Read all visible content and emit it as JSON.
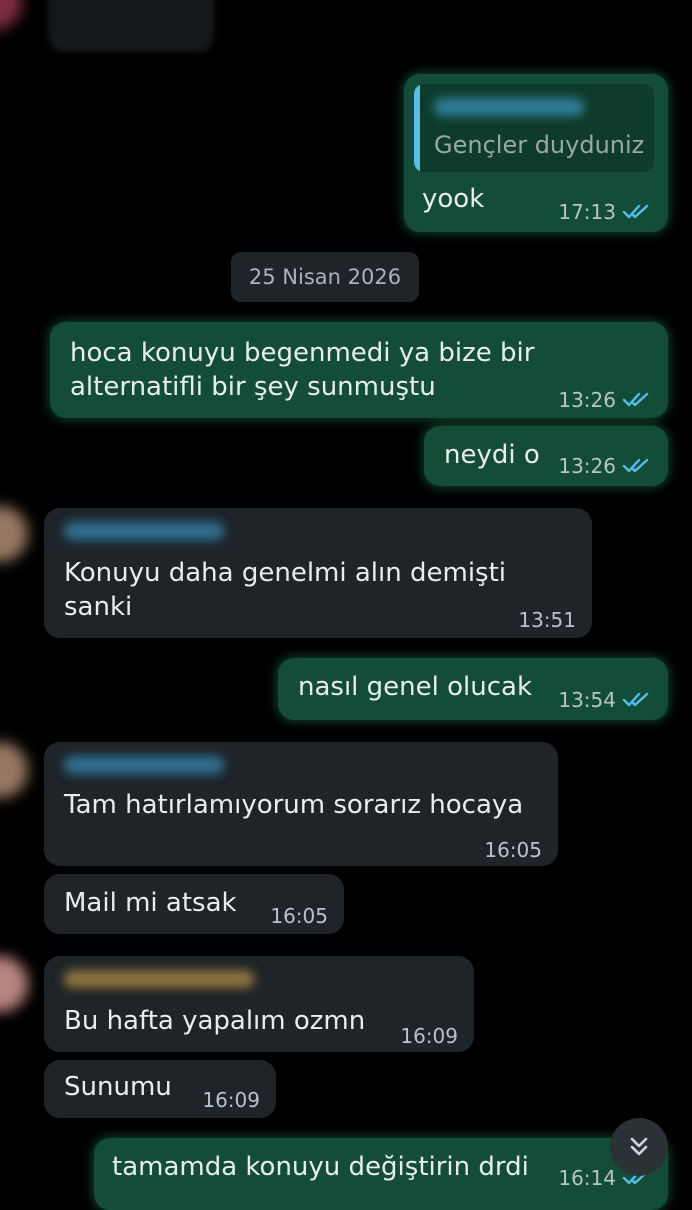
{
  "chat": {
    "date_chip": "25 Nisan 2026",
    "messages": [
      {
        "direction": "outgoing",
        "reply_quote": "Gençler duyduniz",
        "text": "yook",
        "time": "17:13",
        "status": "read"
      },
      {
        "direction": "outgoing",
        "text_line1": "hoca konuyu begenmedi ya bize bir",
        "text_line2": "alternatifli bir şey sunmuştu",
        "time": "13:26",
        "status": "read"
      },
      {
        "direction": "outgoing",
        "text": "neydi o",
        "time": "13:26",
        "status": "read"
      },
      {
        "direction": "incoming",
        "text_line1": "Konuyu daha genelmi alın demişti",
        "text_line2": "sanki",
        "time": "13:51"
      },
      {
        "direction": "outgoing",
        "text": "nasıl genel olucak",
        "time": "13:54",
        "status": "read"
      },
      {
        "direction": "incoming",
        "text": "Tam hatırlamıyorum sorarız hocaya",
        "time": "16:05"
      },
      {
        "direction": "incoming",
        "text": "Mail mi atsak",
        "time": "16:05"
      },
      {
        "direction": "incoming",
        "text": "Bu hafta yapalım ozmn",
        "time": "16:09"
      },
      {
        "direction": "incoming",
        "text": "Sunumu",
        "time": "16:09"
      },
      {
        "direction": "outgoing",
        "text": "tamamda konuyu değiştirin drdi",
        "time": "16:14",
        "status": "read"
      }
    ]
  },
  "icons": {
    "read_receipt": "double-check-icon",
    "scroll_down": "double-chevron-down-icon"
  },
  "colors": {
    "background": "#000000",
    "outgoing_bubble": "#134d37",
    "incoming_bubble": "#1f2428",
    "read_tick": "#53bdeb",
    "reply_accent": "#53bdeb"
  }
}
